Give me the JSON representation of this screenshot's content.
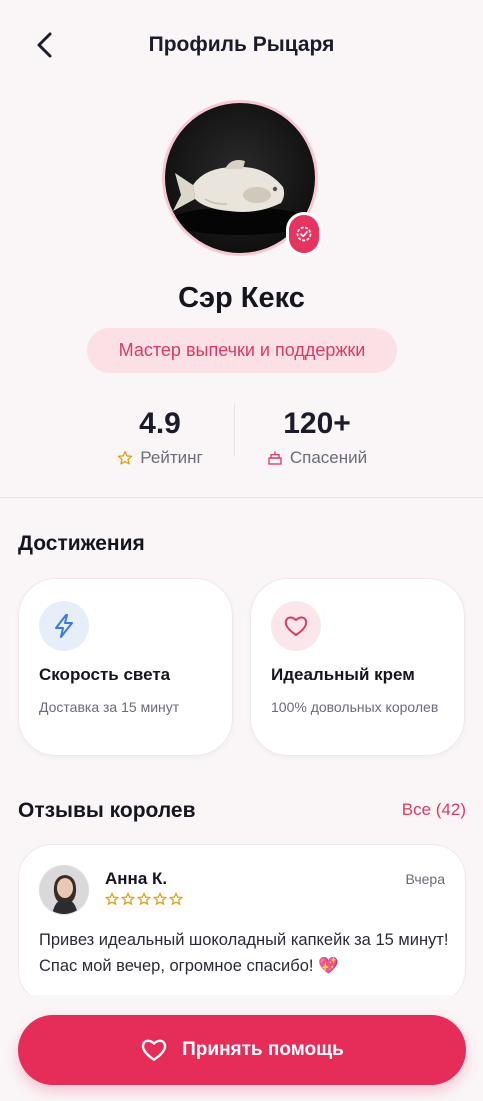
{
  "header": {
    "title": "Профиль Рыцаря",
    "back_icon": "chevron-left-icon"
  },
  "profile": {
    "name": "Сэр Кекс",
    "role": "Мастер выпечки и поддержки",
    "verified_icon": "verified-badge-icon"
  },
  "stats": [
    {
      "value": "4.9",
      "label": "Рейтинг",
      "icon": "star-outline-icon"
    },
    {
      "value": "120+",
      "label": "Спасений",
      "icon": "cake-icon"
    }
  ],
  "achievements": {
    "title": "Достижения",
    "items": [
      {
        "title": "Скорость света",
        "description": "Доставка за 15 минут",
        "icon": "lightning-icon",
        "icon_color": "#3b7ad8",
        "icon_bg": "#e6eef9"
      },
      {
        "title": "Идеальный крем",
        "description": "100% довольных королев",
        "icon": "heart-outline-icon",
        "icon_color": "#d63c63",
        "icon_bg": "#fbe6eb"
      }
    ]
  },
  "reviews": {
    "title": "Отзывы королев",
    "all_link": "Все (42)",
    "items": [
      {
        "name": "Анна К.",
        "date": "Вчера",
        "stars": 5,
        "text": "Привез идеальный шоколадный капкейк за 15 минут! Спас мой вечер, огромное спасибо! 💖"
      }
    ]
  },
  "cta": {
    "label": "Принять помощь",
    "icon": "heart-outline-icon"
  },
  "colors": {
    "accent": "#e62d5a",
    "accent_text": "#d63c63",
    "chip_bg": "#fbe0e6",
    "background": "#faf6f7",
    "star": "#d9a21a"
  }
}
